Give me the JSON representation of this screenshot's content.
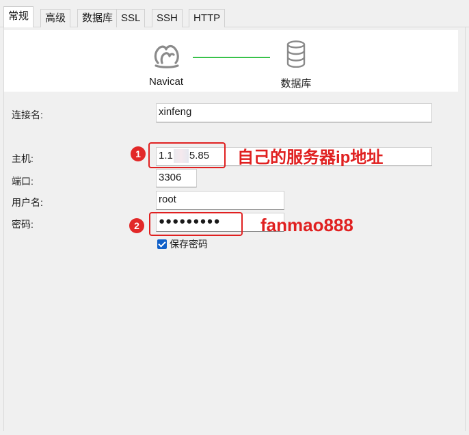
{
  "tabs": [
    {
      "label": "常规",
      "active": true
    },
    {
      "label": "高级",
      "active": false
    },
    {
      "label": "数据库",
      "active": false
    },
    {
      "label": "SSL",
      "active": false
    },
    {
      "label": "SSH",
      "active": false
    },
    {
      "label": "HTTP",
      "active": false
    }
  ],
  "banner": {
    "left_label": "Navicat",
    "right_label": "数据库"
  },
  "form": {
    "connection_name_label": "连接名:",
    "connection_name_value": "xinfeng",
    "host_label": "主机:",
    "host_value_prefix": "1.1",
    "host_value_suffix": "5.85",
    "port_label": "端口:",
    "port_value": "3306",
    "user_label": "用户名:",
    "user_value": "root",
    "password_label": "密码:",
    "password_masked": "●●●●●●●●●",
    "save_password_label": "保存密码",
    "save_password_checked": true
  },
  "annotations": {
    "badge1": "1",
    "note1": "自己的服务器ip地址",
    "badge2": "2",
    "note2": "fanmao888",
    "color": "#e02020"
  }
}
